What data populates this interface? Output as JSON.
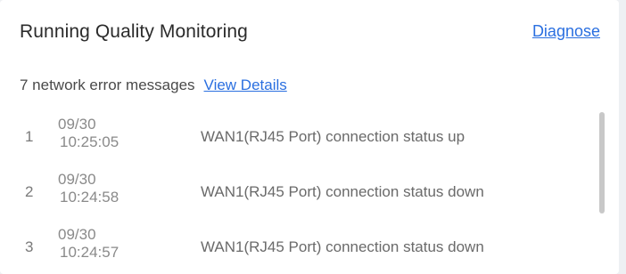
{
  "panel": {
    "title": "Running Quality Monitoring",
    "diagnose_label": "Diagnose",
    "summary_text": "7 network error messages",
    "view_details_label": "View Details"
  },
  "events": [
    {
      "index": "1",
      "date": "09/30",
      "time": "10:25:05",
      "message": "WAN1(RJ45 Port) connection status up"
    },
    {
      "index": "2",
      "date": "09/30",
      "time": "10:24:58",
      "message": "WAN1(RJ45 Port) connection status down"
    },
    {
      "index": "3",
      "date": "09/30",
      "time": "10:24:57",
      "message": "WAN1(RJ45 Port) connection status down"
    }
  ],
  "colors": {
    "link": "#2a6fe0",
    "title": "#2b2b2b",
    "text": "#6a6a6a",
    "background": "#ffffff"
  }
}
